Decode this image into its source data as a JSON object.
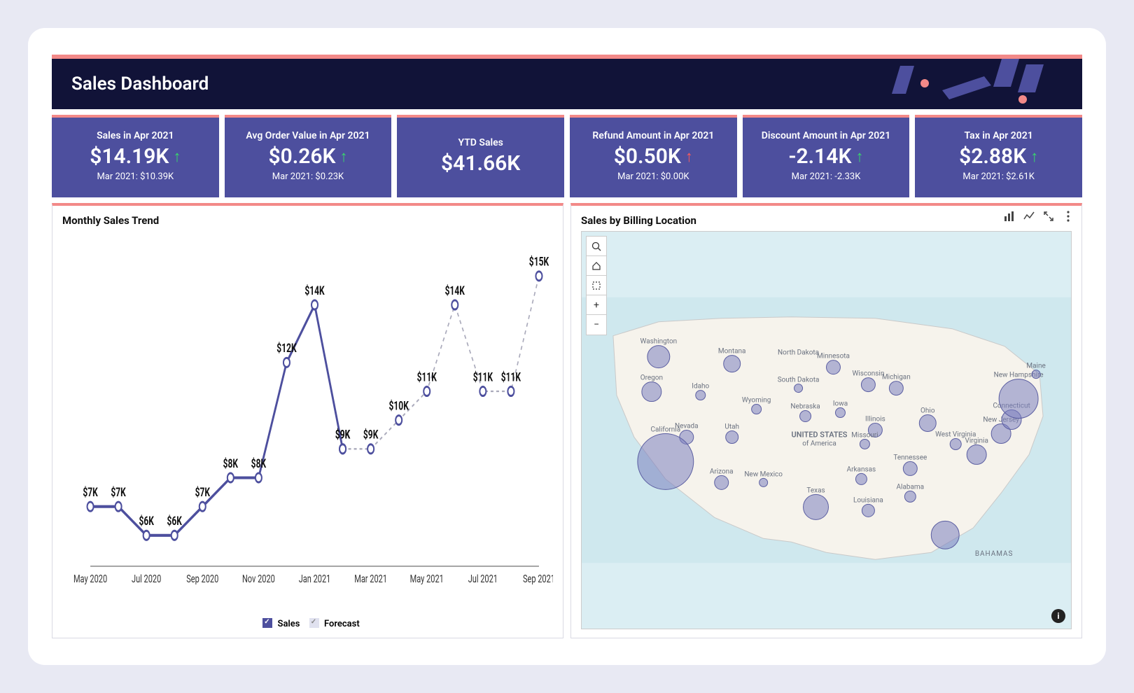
{
  "header": {
    "title": "Sales Dashboard"
  },
  "kpis": [
    {
      "label": "Sales in Apr 2021",
      "value": "$14.19K",
      "arrow": "up",
      "arrow_color": "green",
      "sub": "Mar 2021: $10.39K"
    },
    {
      "label": "Avg Order Value in Apr 2021",
      "value": "$0.26K",
      "arrow": "up",
      "arrow_color": "green",
      "sub": "Mar 2021: $0.23K"
    },
    {
      "label": "YTD Sales",
      "value": "$41.66K",
      "arrow": "",
      "arrow_color": "",
      "sub": ""
    },
    {
      "label": "Refund Amount in Apr 2021",
      "value": "$0.50K",
      "arrow": "up",
      "arrow_color": "red",
      "sub": "Mar 2021: $0.00K"
    },
    {
      "label": "Discount Amount in Apr 2021",
      "value": "-2.14K",
      "arrow": "up",
      "arrow_color": "green",
      "sub": "Mar 2021: -2.33K"
    },
    {
      "label": "Tax in Apr 2021",
      "value": "$2.88K",
      "arrow": "up",
      "arrow_color": "green",
      "sub": "Mar 2021: $2.61K"
    }
  ],
  "panel_left": {
    "title": "Monthly Sales Trend",
    "legend_sales": "Sales",
    "legend_forecast": "Forecast"
  },
  "panel_right": {
    "title": "Sales by Billing Location"
  },
  "map_states": [
    "Washington",
    "Oregon",
    "Montana",
    "Idaho",
    "Nevada",
    "California",
    "Utah",
    "Arizona",
    "New Mexico",
    "Wyoming",
    "North Dakota",
    "South Dakota",
    "Nebraska",
    "Minnesota",
    "Iowa",
    "Wisconsin",
    "Michigan",
    "Illinois",
    "Missouri",
    "Arkansas",
    "Texas",
    "Louisiana",
    "Alabama",
    "Tennessee",
    "Ohio",
    "West Virginia",
    "Virginia",
    "New Jersey",
    "Connecticut",
    "New Hampshire",
    "Maine",
    "BAHAMAS"
  ],
  "map_country": "UNITED STATES of America",
  "chart_data": {
    "type": "line",
    "title": "Monthly Sales Trend",
    "xlabel": "",
    "ylabel": "",
    "x_ticks": [
      "May 2020",
      "Jul 2020",
      "Sep 2020",
      "Nov 2020",
      "Jan 2021",
      "Mar 2021",
      "May 2021",
      "Jul 2021",
      "Sep 2021"
    ],
    "ylim": [
      5,
      16
    ],
    "series": [
      {
        "name": "Sales",
        "x": [
          "May 2020",
          "Jun 2020",
          "Jul 2020",
          "Aug 2020",
          "Sep 2020",
          "Oct 2020",
          "Nov 2020",
          "Dec 2020",
          "Jan 2021",
          "Feb 2021"
        ],
        "values": [
          7,
          7,
          6,
          6,
          7,
          8,
          8,
          12,
          14,
          9
        ],
        "labels": [
          "$7K",
          "$7K",
          "$6K",
          "$6K",
          "$7K",
          "$8K",
          "$8K",
          "$12K",
          "$14K",
          "$9K"
        ]
      },
      {
        "name": "Forecast",
        "x": [
          "Feb 2021",
          "Mar 2021",
          "Apr 2021",
          "May 2021",
          "Jun 2021",
          "Jul 2021",
          "Aug 2021",
          "Sep 2021"
        ],
        "values": [
          9,
          9,
          10,
          11,
          14,
          11,
          11,
          15
        ],
        "labels": [
          "$9K",
          "$9K",
          "$10K",
          "$11K",
          "$14K",
          "$11K",
          "$11K",
          "$15K"
        ]
      }
    ],
    "legend": [
      "Sales",
      "Forecast"
    ]
  }
}
